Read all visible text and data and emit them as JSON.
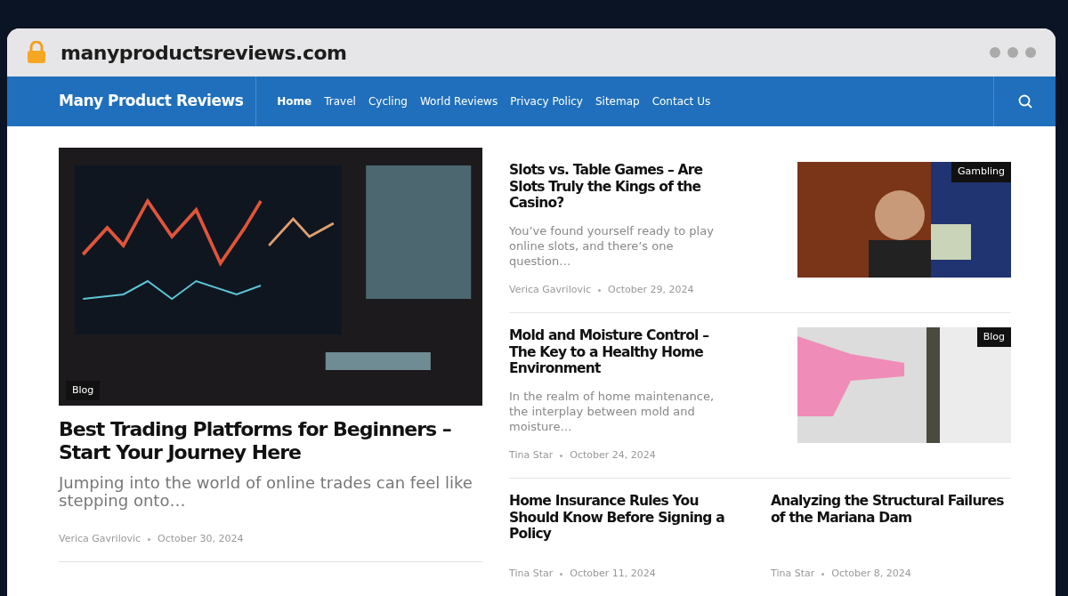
{
  "browser": {
    "url": "manyproductsreviews.com"
  },
  "site": {
    "title": "Many Product Reviews"
  },
  "nav": [
    {
      "label": "Home",
      "selected": true
    },
    {
      "label": "Travel",
      "selected": false
    },
    {
      "label": "Cycling",
      "selected": false
    },
    {
      "label": "World Reviews",
      "selected": false
    },
    {
      "label": "Privacy Policy",
      "selected": false
    },
    {
      "label": "Sitemap",
      "selected": false
    },
    {
      "label": "Contact Us",
      "selected": false
    }
  ],
  "featured": {
    "category": "Blog",
    "title": "Best Trading Platforms for Beginners – Start Your Journey Here",
    "excerpt": "Jumping into the world of online trades can feel like stepping onto…",
    "author": "Verica Gavrilovic",
    "date": "October 30, 2024"
  },
  "posts": [
    {
      "title": "Slots vs. Table Games – Are Slots Truly the Kings of the Casino?",
      "excerpt": "You’ve found yourself ready to play online slots, and there’s one question…",
      "author": "Verica Gavrilovic",
      "date": "October 29, 2024",
      "category": "Gambling"
    },
    {
      "title": "Mold and Moisture Control – The Key to a Healthy Home Environment",
      "excerpt": "In the realm of home maintenance, the interplay between mold and moisture…",
      "author": "Tina Star",
      "date": "October 24, 2024",
      "category": "Blog"
    }
  ],
  "small_posts": [
    {
      "title": "Home Insurance Rules You Should Know Before Signing a Policy",
      "author": "Tina Star",
      "date": "October 11, 2024"
    },
    {
      "title": "Analyzing the Structural Failures of the Mariana Dam",
      "author": "Tina Star",
      "date": "October 8, 2024"
    }
  ]
}
